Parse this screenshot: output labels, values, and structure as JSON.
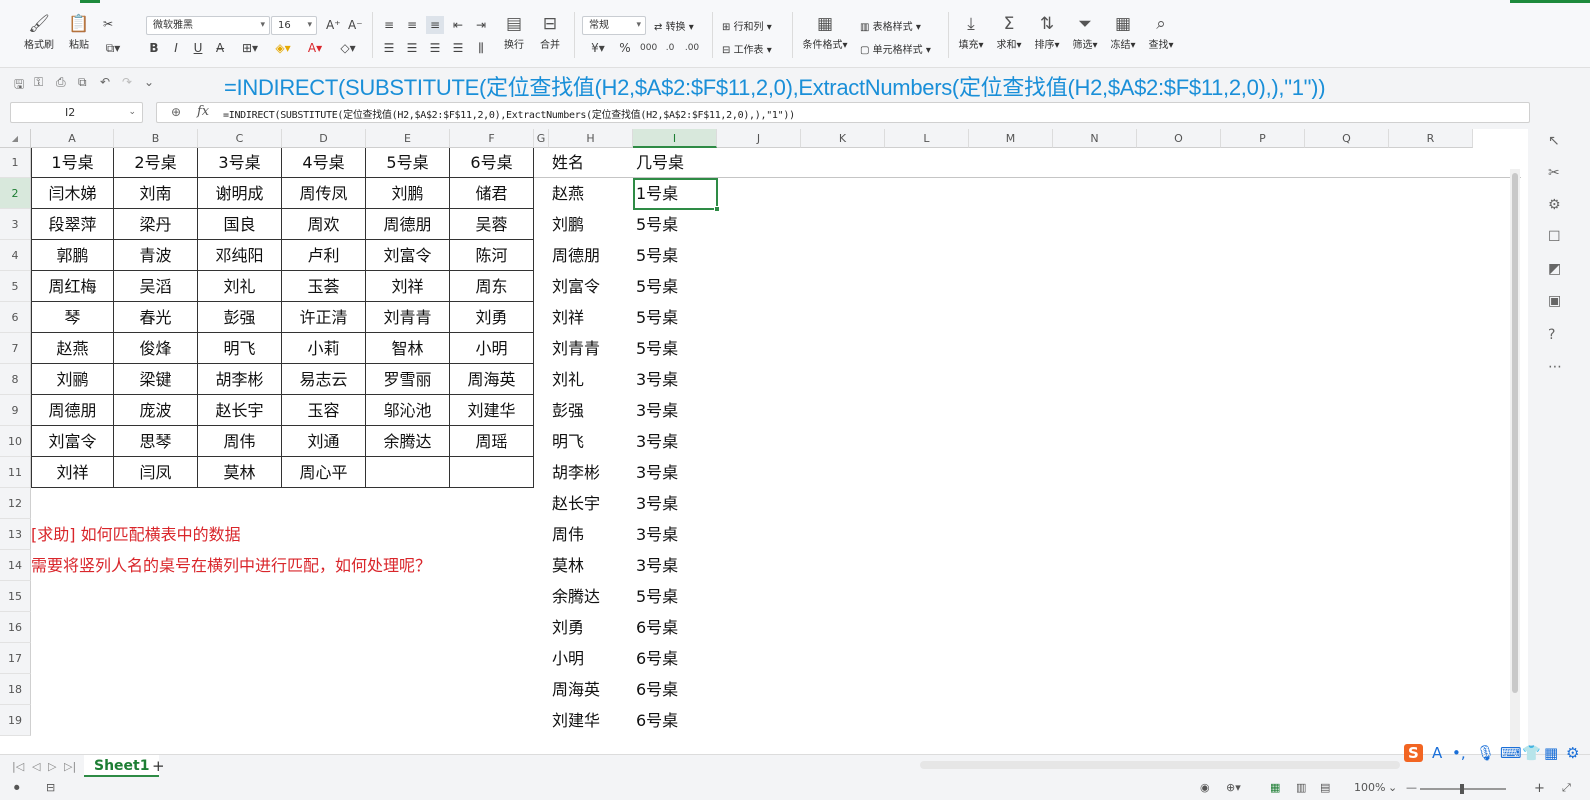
{
  "ribbon": {
    "format_painter": "格式刷",
    "paste": "粘贴",
    "font_name": "微软雅黑",
    "font_size": "16",
    "wrap": "换行",
    "merge": "合并",
    "number_format": "常规",
    "convert": "转换",
    "rows_cols": "行和列",
    "worksheet": "工作表",
    "cond_format": "条件格式",
    "table_style": "表格样式",
    "cell_style": "单元格样式",
    "fill": "填充",
    "sum": "求和",
    "sort": "排序",
    "filter": "筛选",
    "freeze": "冻结",
    "find": "查找"
  },
  "formula_banner": "=INDIRECT(SUBSTITUTE(定位查找值(H2,$A$2:$F$11,2,0),ExtractNumbers(定位查找值(H2,$A$2:$F$11,2,0),),\"1\"))",
  "formula_bar": {
    "cell_ref": "I2",
    "fx": "fx",
    "formula": "=INDIRECT(SUBSTITUTE(定位查找值(H2,$A$2:$F$11,2,0),ExtractNumbers(定位查找值(H2,$A$2:$F$11,2,0),),\"1\"))"
  },
  "columns": [
    "A",
    "B",
    "C",
    "D",
    "E",
    "F",
    "G",
    "H",
    "I",
    "J",
    "K",
    "L",
    "M",
    "N",
    "O",
    "P",
    "Q",
    "R"
  ],
  "rows": [
    "1",
    "2",
    "3",
    "4",
    "5",
    "6",
    "7",
    "8",
    "9",
    "10",
    "11",
    "12",
    "13",
    "14",
    "15",
    "16",
    "17",
    "18",
    "19"
  ],
  "table": {
    "headers": [
      "1号桌",
      "2号桌",
      "3号桌",
      "4号桌",
      "5号桌",
      "6号桌"
    ],
    "rows": [
      [
        "闫木娣",
        "刘南",
        "谢明成",
        "周传凤",
        "刘鹏",
        "储君"
      ],
      [
        "段翠萍",
        "梁丹",
        "国良",
        "周欢",
        "周德朋",
        "吴蓉"
      ],
      [
        "郭鹏",
        "青波",
        "邓纯阳",
        "卢利",
        "刘富令",
        "陈河"
      ],
      [
        "周红梅",
        "吴滔",
        "刘礼",
        "玉荟",
        "刘祥",
        "周东"
      ],
      [
        "琴",
        "春光",
        "彭强",
        "许正清",
        "刘青青",
        "刘勇"
      ],
      [
        "赵燕",
        "俊烽",
        "明飞",
        "小莉",
        "智林",
        "小明"
      ],
      [
        "刘鹂",
        "梁键",
        "胡李彬",
        "易志云",
        "罗雪丽",
        "周海英"
      ],
      [
        "周德朋",
        "庞波",
        "赵长宇",
        "玉容",
        "邬沁池",
        "刘建华"
      ],
      [
        "刘富令",
        "思琴",
        "周伟",
        "刘通",
        "余腾达",
        "周瑶"
      ],
      [
        "刘祥",
        "闫凤",
        "莫林",
        "周心平",
        "",
        ""
      ]
    ]
  },
  "lookup": {
    "header_name": "姓名",
    "header_table": "几号桌",
    "rows": [
      [
        "赵燕",
        "1号桌"
      ],
      [
        "刘鹏",
        "5号桌"
      ],
      [
        "周德朋",
        "5号桌"
      ],
      [
        "刘富令",
        "5号桌"
      ],
      [
        "刘祥",
        "5号桌"
      ],
      [
        "刘青青",
        "5号桌"
      ],
      [
        "刘礼",
        "3号桌"
      ],
      [
        "彭强",
        "3号桌"
      ],
      [
        "明飞",
        "3号桌"
      ],
      [
        "胡李彬",
        "3号桌"
      ],
      [
        "赵长宇",
        "3号桌"
      ],
      [
        "周伟",
        "3号桌"
      ],
      [
        "莫林",
        "3号桌"
      ],
      [
        "余腾达",
        "5号桌"
      ],
      [
        "刘勇",
        "6号桌"
      ],
      [
        "小明",
        "6号桌"
      ],
      [
        "周海英",
        "6号桌"
      ],
      [
        "刘建华",
        "6号桌"
      ]
    ]
  },
  "notes": {
    "line1": "[求助] 如何匹配横表中的数据",
    "line2": "需要将竖列人名的桌号在横列中进行匹配，如何处理呢？"
  },
  "sheet_tab": "Sheet1",
  "zoom": "100%",
  "colors": {
    "accent": "#2e8b45",
    "formula_blue": "#1a8fd8",
    "note_red": "#d9262b"
  }
}
